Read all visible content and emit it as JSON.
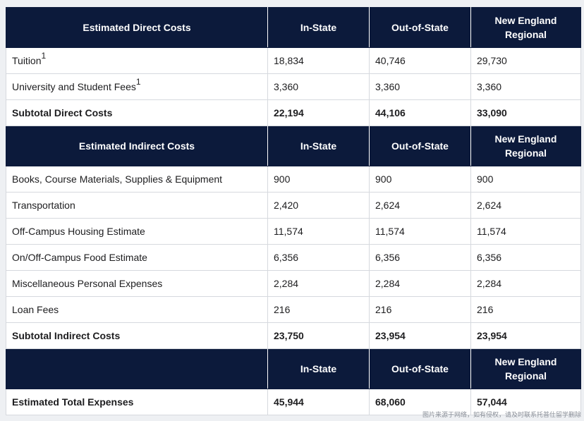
{
  "direct": {
    "header": [
      "Estimated Direct Costs",
      "In-State",
      "Out-of-State",
      "New England Regional"
    ],
    "rows": [
      {
        "label": "Tuition",
        "sup": "1",
        "values": [
          "18,834",
          "40,746",
          "29,730"
        ]
      },
      {
        "label": "University and Student Fees",
        "sup": "1",
        "values": [
          "3,360",
          "3,360",
          "3,360"
        ]
      }
    ],
    "subtotal": {
      "label": "Subtotal Direct Costs",
      "values": [
        "22,194",
        "44,106",
        "33,090"
      ]
    }
  },
  "indirect": {
    "header": [
      "Estimated Indirect Costs",
      "In-State",
      "Out-of-State",
      "New England Regional"
    ],
    "rows": [
      {
        "label": "Books, Course Materials, Supplies & Equipment",
        "values": [
          "900",
          "900",
          "900"
        ]
      },
      {
        "label": "Transportation",
        "values": [
          "2,420",
          "2,624",
          "2,624"
        ]
      },
      {
        "label": "Off-Campus Housing Estimate",
        "values": [
          "11,574",
          "11,574",
          "11,574"
        ]
      },
      {
        "label": "On/Off-Campus Food Estimate",
        "values": [
          "6,356",
          "6,356",
          "6,356"
        ]
      },
      {
        "label": "Miscellaneous Personal Expenses",
        "values": [
          "2,284",
          "2,284",
          "2,284"
        ]
      },
      {
        "label": "Loan Fees",
        "values": [
          "216",
          "216",
          "216"
        ]
      }
    ],
    "subtotal": {
      "label": "Subtotal Indirect Costs",
      "values": [
        "23,750",
        "23,954",
        "23,954"
      ]
    }
  },
  "total": {
    "header": [
      "",
      "In-State",
      "Out-of-State",
      "New England Regional"
    ],
    "row": {
      "label": "Estimated Total Expenses",
      "values": [
        "45,944",
        "68,060",
        "57,044"
      ]
    }
  },
  "watermark": "图片来源于网络，如有侵权，请及时联系托普仕留学删除",
  "colors": {
    "header_bg": "#0c1a3b",
    "header_text": "#ffffff",
    "border": "#d6d9de"
  }
}
